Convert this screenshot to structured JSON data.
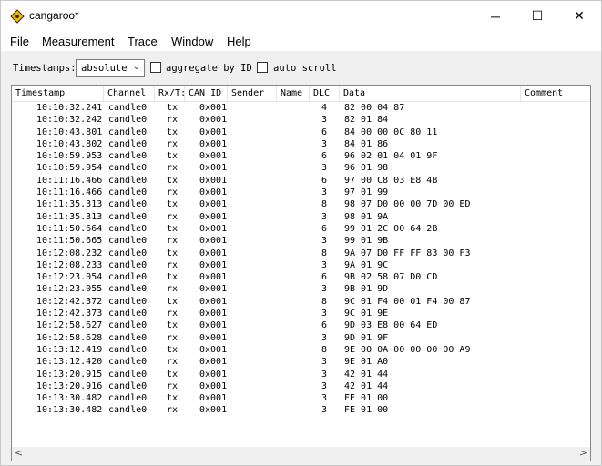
{
  "window": {
    "title": "cangaroo*",
    "minimize": "─",
    "maximize": "☐",
    "close": "✕"
  },
  "menu": [
    "File",
    "Measurement",
    "Trace",
    "Window",
    "Help"
  ],
  "toolbar": {
    "timestamps_label": "Timestamps:",
    "timestamps_value": "absolute",
    "aggregate_label": "aggregate by ID",
    "aggregate_checked": false,
    "autoscroll_label": "auto scroll",
    "autoscroll_checked": false
  },
  "table": {
    "headers": [
      "Timestamp",
      "Channel",
      "Rx/Tx",
      "CAN ID",
      "Sender",
      "Name",
      "DLC",
      "Data",
      "Comment"
    ],
    "header_display": [
      "Timestamp",
      "Channel",
      "Rx/T:",
      "CAN ID",
      "Sender",
      "Name",
      "DLC",
      "Data",
      "Comment"
    ],
    "rows": [
      [
        "10:10:32.241",
        "candle0",
        "tx",
        "0x001",
        "",
        "",
        "4",
        "82 00 04 87",
        ""
      ],
      [
        "10:10:32.242",
        "candle0",
        "rx",
        "0x001",
        "",
        "",
        "3",
        "82 01 84",
        ""
      ],
      [
        "10:10:43.801",
        "candle0",
        "tx",
        "0x001",
        "",
        "",
        "6",
        "84 00 00 0C 80 11",
        ""
      ],
      [
        "10:10:43.802",
        "candle0",
        "rx",
        "0x001",
        "",
        "",
        "3",
        "84 01 86",
        ""
      ],
      [
        "10:10:59.953",
        "candle0",
        "tx",
        "0x001",
        "",
        "",
        "6",
        "96 02 01 04 01 9F",
        ""
      ],
      [
        "10:10:59.954",
        "candle0",
        "rx",
        "0x001",
        "",
        "",
        "3",
        "96 01 98",
        ""
      ],
      [
        "10:11:16.466",
        "candle0",
        "tx",
        "0x001",
        "",
        "",
        "6",
        "97 00 C8 03 E8 4B",
        ""
      ],
      [
        "10:11:16.466",
        "candle0",
        "rx",
        "0x001",
        "",
        "",
        "3",
        "97 01 99",
        ""
      ],
      [
        "10:11:35.313",
        "candle0",
        "tx",
        "0x001",
        "",
        "",
        "8",
        "98 07 D0 00 00 7D 00 ED",
        ""
      ],
      [
        "10:11:35.313",
        "candle0",
        "rx",
        "0x001",
        "",
        "",
        "3",
        "98 01 9A",
        ""
      ],
      [
        "10:11:50.664",
        "candle0",
        "tx",
        "0x001",
        "",
        "",
        "6",
        "99 01 2C 00 64 2B",
        ""
      ],
      [
        "10:11:50.665",
        "candle0",
        "rx",
        "0x001",
        "",
        "",
        "3",
        "99 01 9B",
        ""
      ],
      [
        "10:12:08.232",
        "candle0",
        "tx",
        "0x001",
        "",
        "",
        "8",
        "9A 07 D0 FF FF 83 00 F3",
        ""
      ],
      [
        "10:12:08.233",
        "candle0",
        "rx",
        "0x001",
        "",
        "",
        "3",
        "9A 01 9C",
        ""
      ],
      [
        "10:12:23.054",
        "candle0",
        "tx",
        "0x001",
        "",
        "",
        "6",
        "9B 02 58 07 D0 CD",
        ""
      ],
      [
        "10:12:23.055",
        "candle0",
        "rx",
        "0x001",
        "",
        "",
        "3",
        "9B 01 9D",
        ""
      ],
      [
        "10:12:42.372",
        "candle0",
        "tx",
        "0x001",
        "",
        "",
        "8",
        "9C 01 F4 00 01 F4 00 87",
        ""
      ],
      [
        "10:12:42.373",
        "candle0",
        "rx",
        "0x001",
        "",
        "",
        "3",
        "9C 01 9E",
        ""
      ],
      [
        "10:12:58.627",
        "candle0",
        "tx",
        "0x001",
        "",
        "",
        "6",
        "9D 03 E8 00 64 ED",
        ""
      ],
      [
        "10:12:58.628",
        "candle0",
        "rx",
        "0x001",
        "",
        "",
        "3",
        "9D 01 9F",
        ""
      ],
      [
        "10:13:12.419",
        "candle0",
        "tx",
        "0x001",
        "",
        "",
        "8",
        "9E 00 0A 00 00 00 00 A9",
        ""
      ],
      [
        "10:13:12.420",
        "candle0",
        "rx",
        "0x001",
        "",
        "",
        "3",
        "9E 01 A0",
        ""
      ],
      [
        "10:13:20.915",
        "candle0",
        "tx",
        "0x001",
        "",
        "",
        "3",
        "42 01 44",
        ""
      ],
      [
        "10:13:20.916",
        "candle0",
        "rx",
        "0x001",
        "",
        "",
        "3",
        "42 01 44",
        ""
      ],
      [
        "10:13:30.482",
        "candle0",
        "tx",
        "0x001",
        "",
        "",
        "3",
        "FE 01 00",
        ""
      ],
      [
        "10:13:30.482",
        "candle0",
        "rx",
        "0x001",
        "",
        "",
        "3",
        "FE 01 00",
        ""
      ]
    ]
  },
  "scrollbar": {
    "left_arrow": "<",
    "right_arrow": ">"
  },
  "colors": {
    "icon_fill": "#f5b800",
    "icon_stroke": "#3a2a00",
    "grid_border": "#828790"
  }
}
